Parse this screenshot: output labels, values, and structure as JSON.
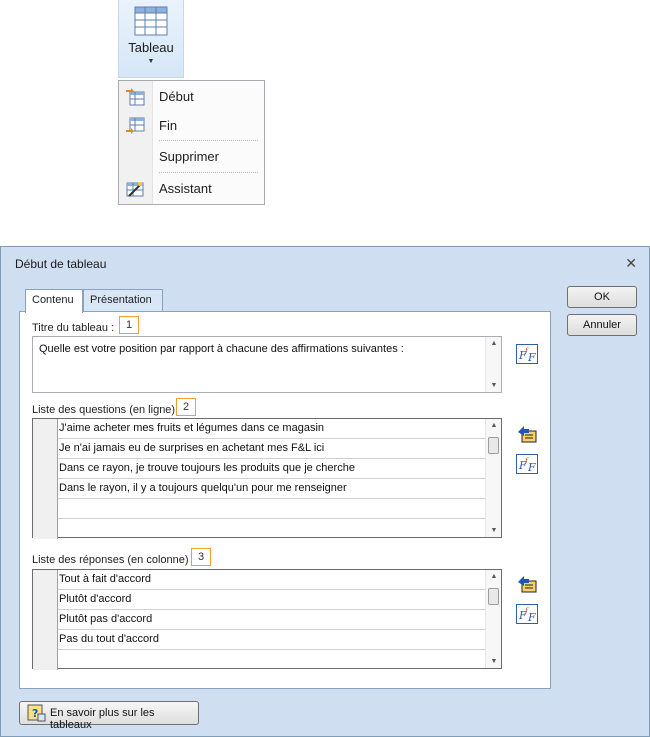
{
  "ribbon": {
    "tableau_label": "Tableau",
    "menu_items": [
      {
        "label": "Début",
        "icon": "table-insert-start-icon"
      },
      {
        "label": "Fin",
        "icon": "table-insert-end-icon"
      },
      {
        "label": "Supprimer",
        "icon": ""
      },
      {
        "label": "Assistant",
        "icon": "wizard-icon"
      }
    ]
  },
  "dialog": {
    "title": "Début de tableau",
    "tabs": [
      "Contenu",
      "Présentation"
    ],
    "active_tab": "Contenu",
    "ok_label": "OK",
    "cancel_label": "Annuler",
    "help_label": "En savoir plus sur les tableaux",
    "title_section": {
      "label": "Titre du tableau :",
      "badge": "1",
      "value": "Quelle est votre position par rapport à chacune des affirmations suivantes :"
    },
    "questions_section": {
      "label": "Liste des questions (en ligne)",
      "badge": "2",
      "rows": [
        "J'aime acheter mes fruits et légumes dans ce magasin",
        "Je n'ai jamais eu de surprises en achetant mes F&L ici",
        "Dans ce rayon, je trouve toujours les produits que je cherche",
        "Dans le rayon, il y a toujours quelqu'un pour me renseigner"
      ]
    },
    "answers_section": {
      "label": "Liste des réponses (en colonne)",
      "badge": "3",
      "rows": [
        "Tout à fait d'accord",
        "Plutôt d'accord",
        "Plutôt pas d'accord",
        "Pas du tout d'accord"
      ]
    }
  },
  "colors": {
    "dialog_bg": "#cfdef0",
    "badge_border": "#f0a030",
    "ribbon_highlight": "#d5e6f7"
  }
}
